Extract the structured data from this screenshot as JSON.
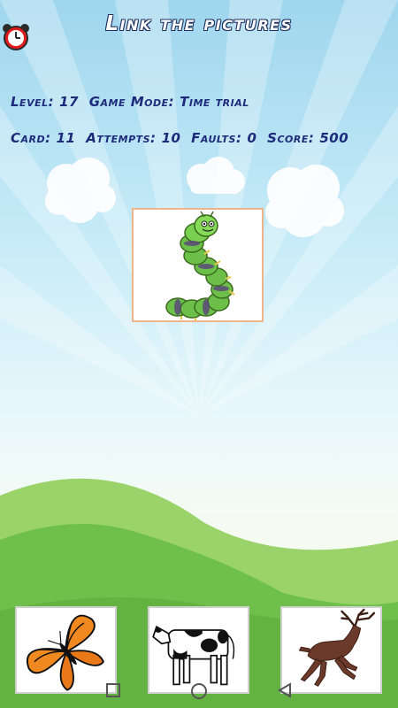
{
  "header": {
    "title": "Link the pictures",
    "alarm_icon": "alarm-clock-icon"
  },
  "stats": {
    "level_label": "Level:",
    "level_value": "17",
    "mode_label": "Game Mode:",
    "mode_value": "Time trial",
    "card_label": "Card:",
    "card_value": "11",
    "attempts_label": "Attempts:",
    "attempts_value": "10",
    "faults_label": "Faults:",
    "faults_value": "0",
    "score_label": "Score:",
    "score_value": "500"
  },
  "target": {
    "icon": "caterpillar-icon"
  },
  "choices": [
    {
      "icon": "butterfly-icon"
    },
    {
      "icon": "cow-icon"
    },
    {
      "icon": "deer-icon"
    }
  ],
  "nav": {
    "recent_icon": "square-icon",
    "home_icon": "circle-icon",
    "back_icon": "triangle-back-icon"
  },
  "colors": {
    "stat_text": "#1e2a7a",
    "card_border": "#f0b48a",
    "hill_dark": "#6fc04a",
    "hill_light": "#9ad36a"
  }
}
